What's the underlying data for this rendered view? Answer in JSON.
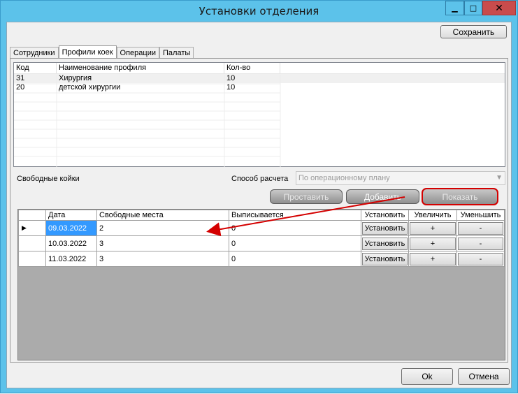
{
  "window": {
    "title": "Установки отделения",
    "min_glyph": "▁",
    "max_glyph": "□",
    "close_glyph": "✕"
  },
  "toolbar": {
    "save_label": "Сохранить"
  },
  "tabs": [
    {
      "label": "Сотрудники"
    },
    {
      "label": "Профили коек"
    },
    {
      "label": "Операции"
    },
    {
      "label": "Палаты"
    }
  ],
  "profiles": {
    "columns": [
      "Код",
      "Наименование профиля",
      "Кол-во"
    ],
    "rows": [
      {
        "code": "31",
        "name": "Хирургия",
        "count": "10"
      },
      {
        "code": "20",
        "name": "детской хирургии",
        "count": "10"
      }
    ]
  },
  "free_beds": {
    "label": "Свободные койки",
    "calc_label": "Способ расчета",
    "calc_value": "По операционному плану",
    "buttons": {
      "set": "Проставить",
      "add": "Добавить",
      "show": "Показать"
    }
  },
  "grid": {
    "columns": [
      "Дата",
      "Свободные места",
      "Выписывается",
      "Установить",
      "Увеличить",
      "Уменьшить"
    ],
    "current_row_marker": "▶",
    "rows": [
      {
        "date": "09.03.2022",
        "free": "2",
        "discharged": "0",
        "set": "Установить",
        "inc": "+",
        "dec": "-"
      },
      {
        "date": "10.03.2022",
        "free": "3",
        "discharged": "0",
        "set": "Установить",
        "inc": "+",
        "dec": "-"
      },
      {
        "date": "11.03.2022",
        "free": "3",
        "discharged": "0",
        "set": "Установить",
        "inc": "+",
        "dec": "-"
      }
    ]
  },
  "footer": {
    "ok_label": "Ok",
    "cancel_label": "Отмена"
  },
  "colors": {
    "titlebar": "#5cc2ea",
    "selection": "#3399ff",
    "annotation_red": "#d40000"
  }
}
